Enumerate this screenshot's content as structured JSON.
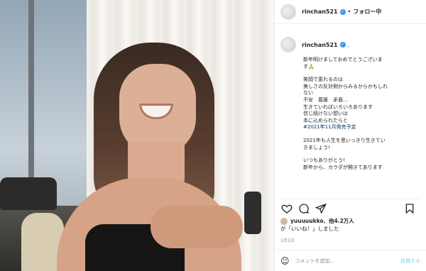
{
  "header": {
    "username": "rinchan521",
    "follow_label": "フォロー中"
  },
  "post": {
    "username": "rinchan521",
    "caption_lines_1": [
      "新年明けましておめでとうございま",
      "す🙏"
    ],
    "caption_lines_2": [
      "笑顔で恵れるのは",
      "美しさの反対側からみるからかもしれ",
      "ない",
      "不安　葛藤　矛盾…",
      "生きていればいろいろあります",
      "信じ続けない想いは",
      "本に込められたらと"
    ],
    "hashtag": "#2021年11月発売予定",
    "caption_lines_3": [
      "2021年も人生を思いっきり生きてい",
      "きましょう!"
    ],
    "caption_lines_4": [
      "いつもありがとう!",
      "新年から、カラダが開きてあります"
    ]
  },
  "likes": {
    "user": "yuuuuukko",
    "count_text": "、他4.2万人",
    "suffix": "が「いいね！」しました"
  },
  "date": "1月1日",
  "comment": {
    "placeholder": "コメントを追加...",
    "post_label": "投稿する"
  },
  "icons": [
    "heart-icon",
    "comment-icon",
    "share-icon",
    "bookmark-icon",
    "verified-icon",
    "emoji-icon"
  ],
  "colors": {
    "verified": "#3897f0",
    "hashtag": "#00376b"
  }
}
